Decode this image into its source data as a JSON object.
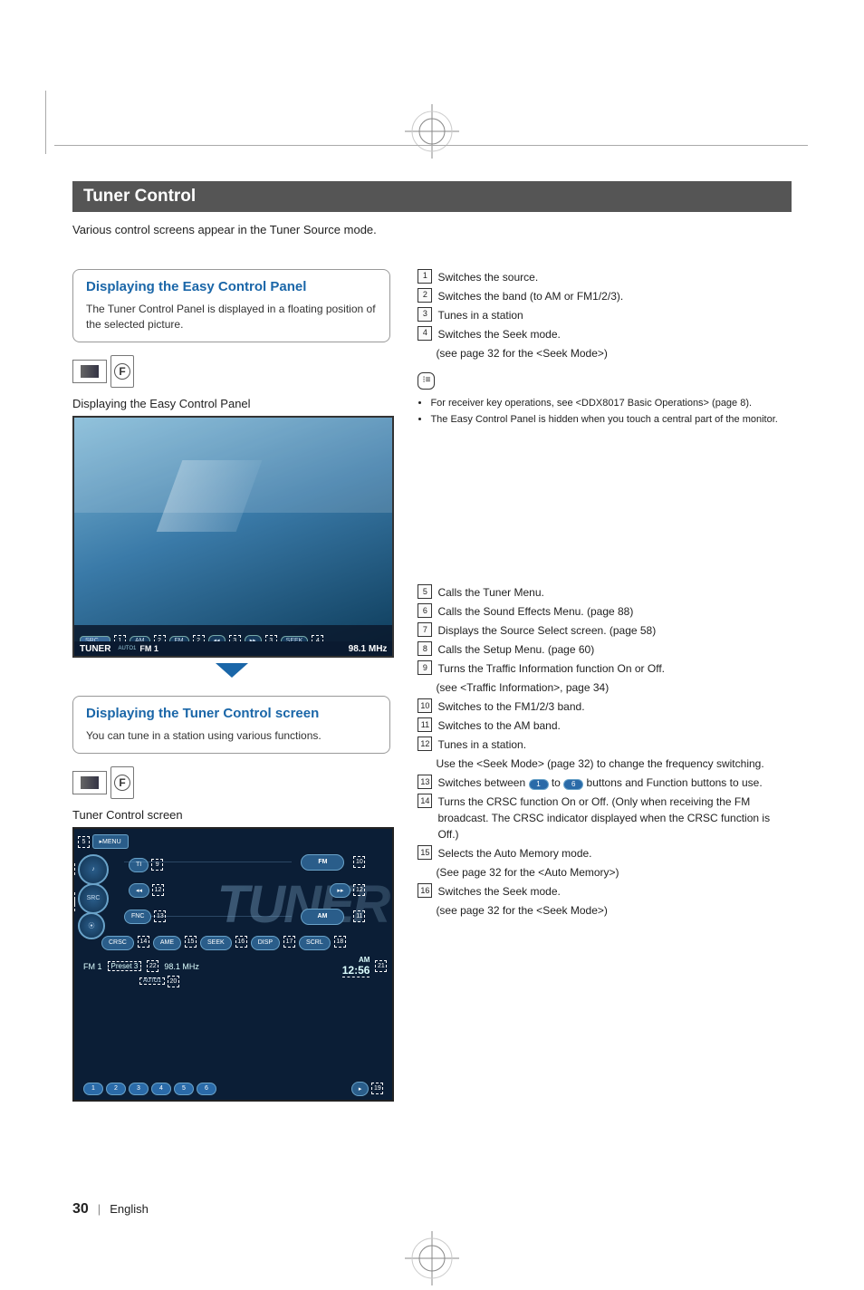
{
  "header": {
    "title": "Tuner Control"
  },
  "intro": "Various control screens appear in the Tuner Source mode.",
  "panel_easy": {
    "title": "Displaying the Easy Control Panel",
    "text": "The Tuner Control Panel is displayed in a floating position of the selected picture.",
    "subheading": "Displaying the Easy Control Panel",
    "icons": {
      "screen": "",
      "f": "F"
    },
    "screen": {
      "src": "SRC",
      "am": "AM",
      "fm": "FM",
      "prev": "◂◂",
      "next": "▸▸",
      "seek": "SEEK",
      "label": "TUNER",
      "auto1": "AUTO1",
      "band": "FM 1",
      "freq": "98.1 MHz",
      "c1": "1",
      "c2": "2",
      "c3": "3",
      "c4": "4"
    }
  },
  "desc_easy": {
    "i1": {
      "n": "1",
      "t": "Switches the source."
    },
    "i2": {
      "n": "2",
      "t": "Switches the band (to AM or FM1/2/3)."
    },
    "i3": {
      "n": "3",
      "t": "Tunes in a station"
    },
    "i4": {
      "n": "4",
      "t": "Switches the Seek mode."
    },
    "i4b": "(see page 32 for the <Seek Mode>)"
  },
  "notes_easy": {
    "b1": "For receiver key operations, see <DDX8017 Basic Operations> (page 8).",
    "b2": "The Easy Control Panel is hidden when you touch a central part of the monitor."
  },
  "panel_tuner": {
    "title": "Displaying the Tuner Control screen",
    "text": "You can tune in a station using various functions.",
    "subheading": "Tuner Control screen",
    "screen": {
      "menu": "▸MENU",
      "ti": "TI",
      "fm": "FM",
      "am": "AM",
      "src": "SRC",
      "fnc": "FNC",
      "crsc": "CRSC",
      "ame": "AME",
      "seek": "SEEK",
      "disp": "DISP",
      "scrl": "SCRL",
      "band": "FM 1",
      "preset": "Preset  3",
      "freq": "98.1  MHz",
      "right_am": "AM",
      "clock": "12:56",
      "auto1": "AUTO1",
      "numbers": [
        "1",
        "2",
        "3",
        "4",
        "5",
        "6"
      ],
      "bg": "TUNER",
      "c5": "5",
      "c6": "6",
      "c7": "7",
      "c8": "8",
      "c9": "9",
      "c10": "10",
      "c11": "11",
      "c12": "12",
      "c13": "13",
      "c14": "14",
      "c15": "15",
      "c16": "16",
      "c17": "17",
      "c18": "18",
      "c19": "19",
      "c20": "20",
      "c21": "21",
      "c22": "22"
    }
  },
  "desc_tuner": {
    "i5": {
      "n": "5",
      "t": "Calls the Tuner Menu."
    },
    "i6": {
      "n": "6",
      "t": "Calls the Sound Effects Menu. (page 88)"
    },
    "i7": {
      "n": "7",
      "t": "Displays the Source Select screen. (page 58)"
    },
    "i8": {
      "n": "8",
      "t": "Calls the Setup Menu. (page 60)"
    },
    "i9": {
      "n": "9",
      "t": "Turns the Traffic Information function On or Off."
    },
    "i9b": "(see <Traffic Information>, page 34)",
    "i10": {
      "n": "10",
      "t": "Switches to the FM1/2/3 band."
    },
    "i11": {
      "n": "11",
      "t": "Switches to the AM band."
    },
    "i12": {
      "n": "12",
      "t": "Tunes in a station."
    },
    "i12b": "Use the <Seek Mode> (page 32) to change the frequency switching.",
    "i13a": "Switches between ",
    "i13_1": "1",
    "i13mid": " to ",
    "i13_6": "6",
    "i13b": " buttons and Function buttons to use.",
    "i13n": "13",
    "i14": {
      "n": "14",
      "t": "Turns the CRSC function On or Off. (Only when receiving the FM broadcast. The CRSC indicator displayed when the CRSC function is Off.)"
    },
    "i15": {
      "n": "15",
      "t": "Selects the Auto Memory mode."
    },
    "i15b": "(See page 32 for the <Auto Memory>)",
    "i16": {
      "n": "16",
      "t": "Switches the Seek mode."
    },
    "i16b": "(see page 32 for the <Seek Mode>)"
  },
  "footer": {
    "page": "30",
    "lang": "English"
  }
}
